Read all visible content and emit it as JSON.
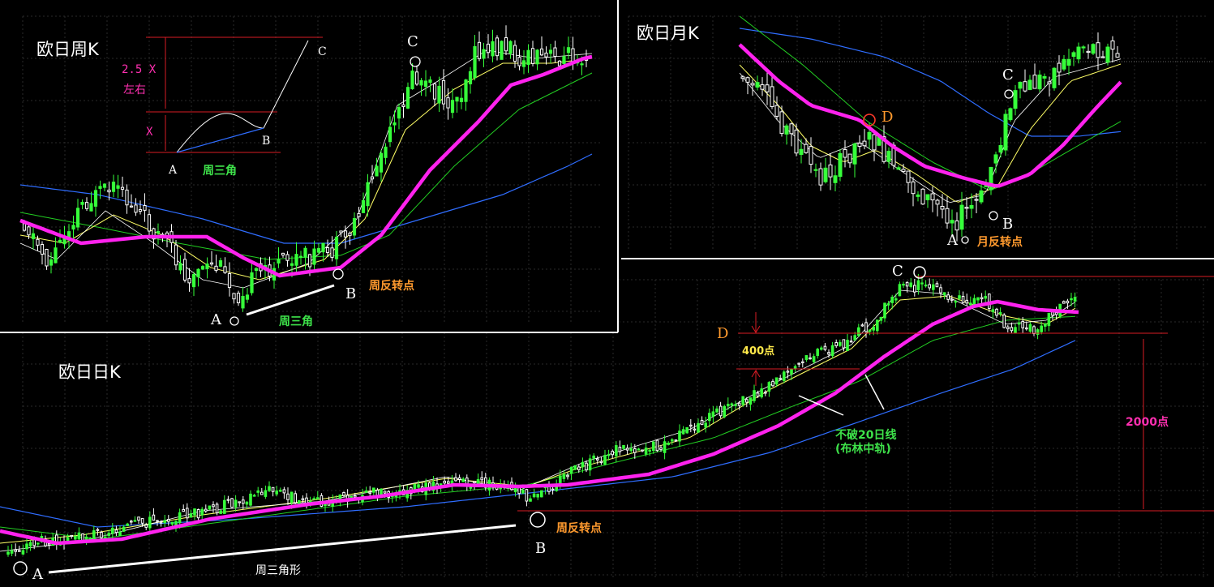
{
  "panels": {
    "weekly": {
      "title": "欧日周K",
      "labels": {
        "a": "A",
        "b": "B",
        "c": "C",
        "reversal": "周反转点",
        "triangle": "周三角"
      },
      "schematic": {
        "ratio": "2.5 X",
        "approx": "左右",
        "x": "X",
        "a": "A",
        "b": "B",
        "c": "C",
        "triangle": "周三角"
      }
    },
    "monthly": {
      "title": "欧日月K",
      "labels": {
        "a": "A",
        "b": "B",
        "c": "C",
        "d": "D",
        "reversal": "月反转点"
      }
    },
    "daily": {
      "title": "欧日日K",
      "labels": {
        "a": "A",
        "b": "B",
        "c": "C",
        "d": "D",
        "reversal": "周反转点",
        "triangle": "周三角形",
        "pts400": "400点",
        "pts2000": "2000点",
        "note1": "不破20日线",
        "note2": "(布林中轨)"
      }
    }
  },
  "colors": {
    "background": "#000000",
    "grid": "#2a2a2a",
    "up_candle": "#36ff3a",
    "down_candle": "#ffffff",
    "ma_main": "#ff22ee",
    "ma_fast": "#ffff66",
    "ma_mid": "#22cc22",
    "ma_slow": "#2f6dff",
    "annotation_red": "#d81b24",
    "annotation_orange": "#ff9a2e"
  },
  "chart_data": [
    {
      "type": "line",
      "series": [],
      "title": "欧日周K"
    },
    {
      "type": "line",
      "series": [],
      "title": "欧日月K"
    },
    {
      "type": "line",
      "series": [],
      "title": "欧日日K"
    }
  ]
}
